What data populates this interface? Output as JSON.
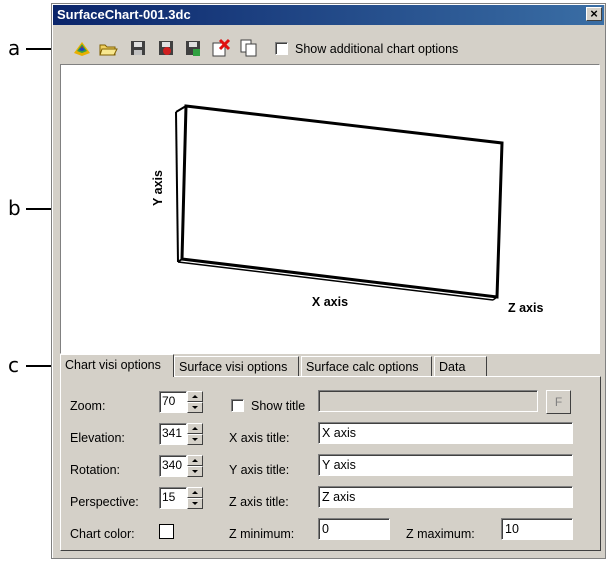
{
  "window": {
    "title": "SurfaceChart-001.3dc",
    "close_glyph": "×"
  },
  "callouts": {
    "a": "a",
    "b": "b",
    "c": "c"
  },
  "toolbar": {
    "icons": [
      "surface-chart-icon",
      "open-folder-icon",
      "save-icon",
      "save-as-icon",
      "export-icon",
      "delete-icon",
      "copy-icon"
    ],
    "show_additional_label": "Show additional chart options",
    "show_additional_checked": false
  },
  "chart": {
    "x_axis_label": "X axis",
    "y_axis_label": "Y axis",
    "z_axis_label": "Z axis"
  },
  "tabs": [
    {
      "label": "Chart visi options",
      "active": true
    },
    {
      "label": "Surface visi options",
      "active": false
    },
    {
      "label": "Surface calc options",
      "active": false
    },
    {
      "label": "Data",
      "active": false
    }
  ],
  "chart_visi": {
    "zoom_label": "Zoom:",
    "zoom_value": "70",
    "elevation_label": "Elevation:",
    "elevation_value": "341",
    "rotation_label": "Rotation:",
    "rotation_value": "340",
    "perspective_label": "Perspective:",
    "perspective_value": "15",
    "chart_color_label": "Chart color:",
    "show_title_label": "Show title",
    "show_title_checked": false,
    "title_value": "",
    "font_button_label": "F",
    "x_axis_title_label": "X axis title:",
    "x_axis_title_value": "X axis",
    "y_axis_title_label": "Y axis title:",
    "y_axis_title_value": "Y axis",
    "z_axis_title_label": "Z axis title:",
    "z_axis_title_value": "Z axis",
    "z_min_label": "Z minimum:",
    "z_min_value": "0",
    "z_max_label": "Z maximum:",
    "z_max_value": "10"
  },
  "colors": {
    "titlebar_start": "#0a246a",
    "titlebar_end": "#3a6ea5",
    "face": "#d4d0c8"
  }
}
